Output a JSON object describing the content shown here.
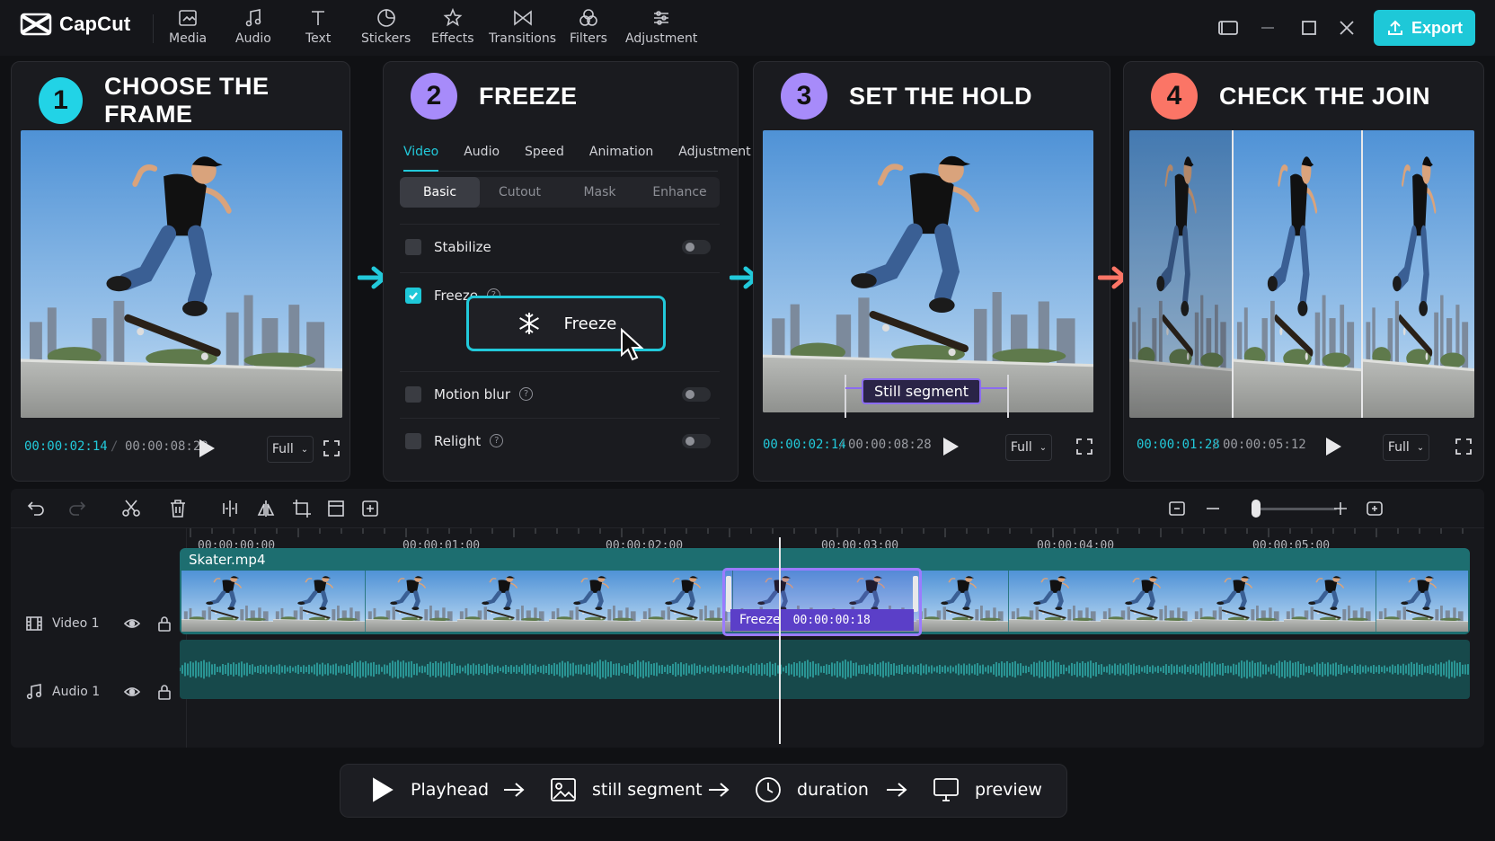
{
  "app": {
    "name": "CapCut",
    "export_label": "Export"
  },
  "toolbar": [
    {
      "label": "Media",
      "icon": "media-icon"
    },
    {
      "label": "Audio",
      "icon": "audio-icon"
    },
    {
      "label": "Text",
      "icon": "text-icon"
    },
    {
      "label": "Stickers",
      "icon": "stickers-icon"
    },
    {
      "label": "Effects",
      "icon": "effects-icon"
    },
    {
      "label": "Transitions",
      "icon": "transitions-icon"
    },
    {
      "label": "Filters",
      "icon": "filters-icon"
    },
    {
      "label": "Adjustment",
      "icon": "adjustment-icon"
    }
  ],
  "steps": [
    {
      "num": "1",
      "title": "CHOOSE THE FRAME",
      "color": "#22d3e6",
      "current": "00:00:02:14",
      "total": "00:00:08:28",
      "scale": "Full"
    },
    {
      "num": "2",
      "title": "FREEZE",
      "color": "#a78bfa"
    },
    {
      "num": "3",
      "title": "SET THE HOLD",
      "color": "#a78bfa",
      "current": "00:00:02:14",
      "total": "00:00:08:28",
      "scale": "Full",
      "still_label": "Still segment"
    },
    {
      "num": "4",
      "title": "CHECK THE JOIN",
      "color": "#fb7566",
      "current": "00:00:01:28",
      "total": "00:00:05:12",
      "scale": "Full"
    }
  ],
  "freeze_panel": {
    "tabs": [
      "Video",
      "Audio",
      "Speed",
      "Animation",
      "Adjustment"
    ],
    "active_tab": "Video",
    "subtabs": [
      "Basic",
      "Cutout",
      "Mask",
      "Enhance"
    ],
    "active_subtab": "Basic",
    "options": {
      "stabilize": {
        "label": "Stabilize",
        "checked": false
      },
      "freeze": {
        "label": "Freeze",
        "checked": true
      },
      "motion_blur": {
        "label": "Motion blur",
        "checked": false
      },
      "relight": {
        "label": "Relight",
        "checked": false
      }
    },
    "freeze_button": "Freeze",
    "help_glyph": "?"
  },
  "arrows": {
    "a1": "#22c9da",
    "a2": "#22c9da",
    "a3": "#fb7566"
  },
  "timeline": {
    "ruler": [
      "00:00:00:00",
      "00:00:01:00",
      "00:00:02:00",
      "00:00:03:00",
      "00:00:04:00",
      "00:00:05:00"
    ],
    "tracks": [
      {
        "name": "Video 1",
        "icon": "film-icon"
      },
      {
        "name": "Audio 1",
        "icon": "music-note-icon"
      }
    ],
    "clip_name": "Skater.mp4",
    "freeze_segment": {
      "label": "Freeze",
      "duration": "00:00:00:18"
    }
  },
  "flow": [
    "Playhead",
    "still segment",
    "duration",
    "preview"
  ]
}
